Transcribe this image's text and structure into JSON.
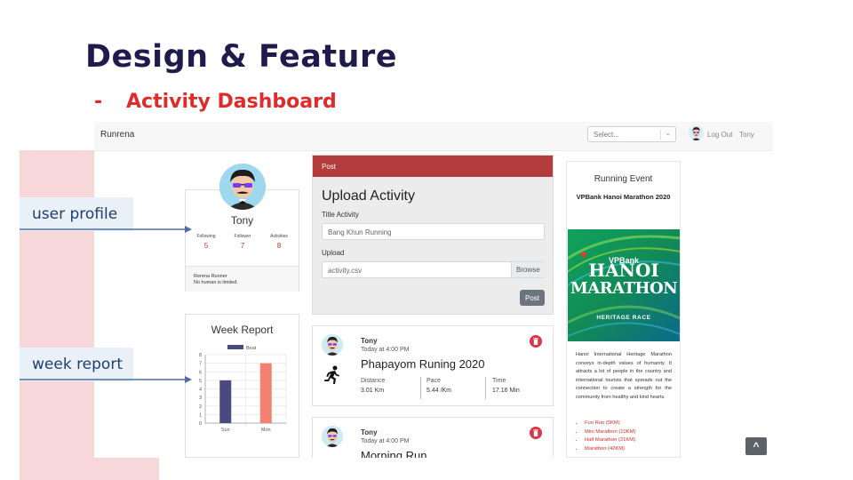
{
  "slide": {
    "title": "Design & Feature",
    "bullet": "-",
    "subtitle": "Activity Dashboard"
  },
  "annotations": {
    "user_profile": "user profile",
    "week_report": "week report"
  },
  "navbar": {
    "brand": "Runrena",
    "select_placeholder": "Select...",
    "logout": "Log Out",
    "username": "Tony"
  },
  "profile": {
    "name": "Tony",
    "stats": [
      {
        "label": "Following",
        "value": "5"
      },
      {
        "label": "Follower",
        "value": "7"
      },
      {
        "label": "Activities",
        "value": "8"
      }
    ],
    "bio_line1": "Rerena Runner",
    "bio_line2": "No human is limited."
  },
  "week_report": {
    "title": "Week Report",
    "chart_data": {
      "type": "bar",
      "categories": [
        "Sun",
        "Mon"
      ],
      "series": [
        {
          "name": "Beat",
          "values": [
            5,
            7
          ]
        }
      ],
      "colors": [
        "#4a4a80",
        "#f48072"
      ],
      "legend": "Beat",
      "ylim": [
        0,
        8
      ],
      "yticks": [
        "0",
        "1",
        "2",
        "3",
        "4",
        "5",
        "6",
        "7",
        "8"
      ],
      "grid": true
    }
  },
  "post": {
    "header": "Post",
    "title": "Upload Activity",
    "title_label": "Title Activity",
    "title_value": "Bang Khun Running",
    "upload_label": "Upload",
    "file_value": "activity.csv",
    "browse_label": "Browse",
    "submit_label": "Post"
  },
  "activities": [
    {
      "user": "Tony",
      "time": "Today at 4:00 PM",
      "title": "Phapayom Runing 2020",
      "distance_label": "Distance",
      "distance": "3.01 Km",
      "pace_label": "Pace",
      "pace": "5.44 /Km",
      "time_label": "Time",
      "duration": "17.16 Min"
    },
    {
      "user": "Tony",
      "time": "Today at 4:00 PM",
      "title": "Morning Run"
    }
  ],
  "event": {
    "heading": "Running Event",
    "name": "VPBank Hanoi Marathon 2020",
    "banner_brand": "VPBank",
    "banner_line1": "HANOI",
    "banner_line2": "MARATHON",
    "banner_line3": "HERITAGE RACE",
    "description": "Hanoi International Heritage Marathon conveys in-depth values of humanity. It attracts a lot of people in the country and international tourists that spreads out the connection to create a strength for the community from healthy and kind hearts.",
    "races": [
      "Fun Run (5KM)",
      "Mini Marathon (10KM)",
      "Half Marathon (21KM)",
      "Marathon (42KM)"
    ]
  },
  "scroll_top_label": "^"
}
